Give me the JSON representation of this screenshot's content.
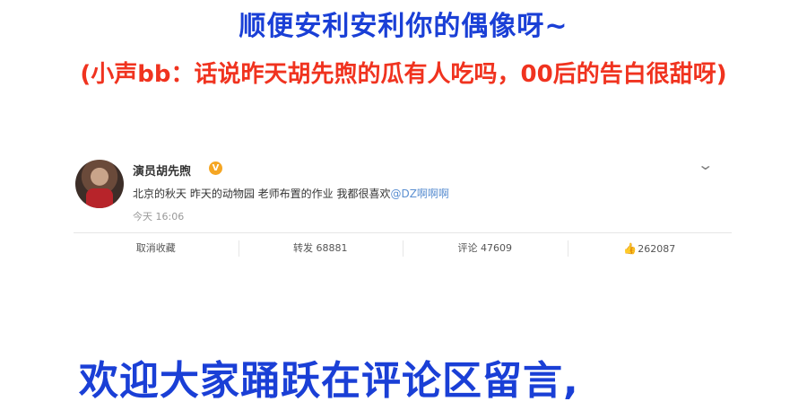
{
  "captions": {
    "top": "顺便安利安利你的偶像呀~",
    "sub": "(小声bb：话说昨天胡先煦的瓜有人吃吗，00后的告白很甜呀)",
    "bottom": "欢迎大家踊跃在评论区留言,"
  },
  "post": {
    "username": "演员胡先煦",
    "verified_icon": "V",
    "text": "北京的秋天 昨天的动物园 老师布置的作业 我都很喜欢",
    "mention": "@DZ啊啊啊",
    "time": "今天 16:06",
    "menu_icon": "chevron-down-icon"
  },
  "actions": {
    "favorite": "取消收藏",
    "repost": "转发 68881",
    "comment": "评论 47609",
    "like_icon": "👍",
    "like_count": "262087"
  },
  "colors": {
    "caption_blue": "#1a3fd6",
    "caption_red": "#f0331f",
    "mention_blue": "#5b8fd1",
    "verify_orange": "#f5a623"
  }
}
